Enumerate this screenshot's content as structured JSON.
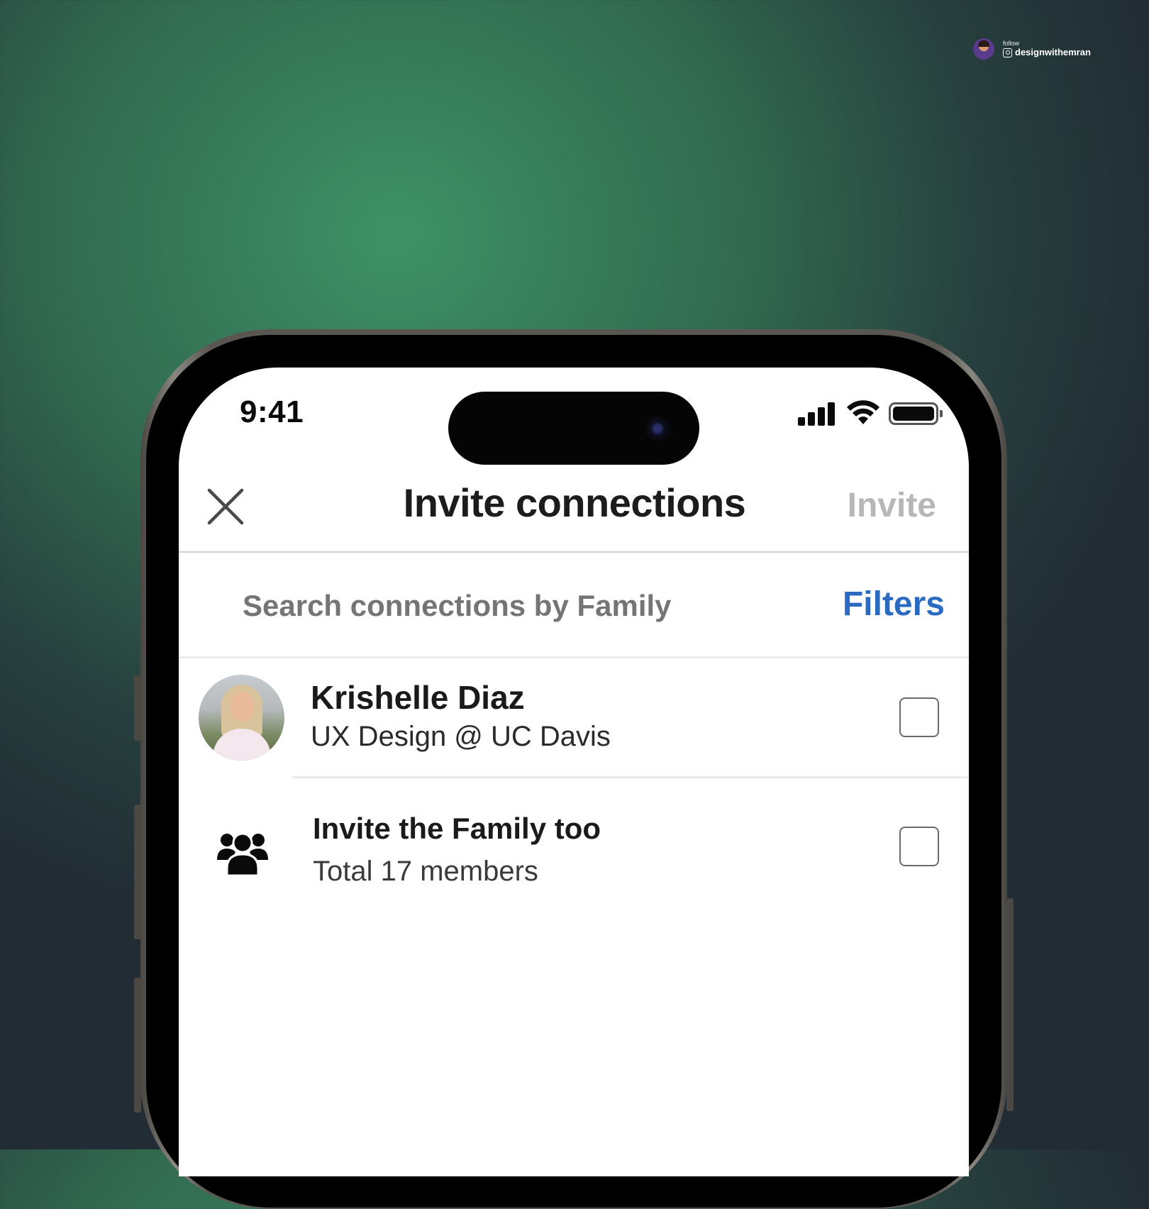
{
  "watermark": {
    "follow_label": "follow",
    "handle": "designwithemran",
    "icon": "instagram-icon"
  },
  "status_bar": {
    "time": "9:41",
    "icons": [
      "cellular-signal-icon",
      "wifi-icon",
      "battery-icon"
    ]
  },
  "header": {
    "close_icon": "close-icon",
    "title": "Invite connections",
    "invite_label": "Invite"
  },
  "search": {
    "placeholder": "Search connections by Family",
    "filters_label": "Filters"
  },
  "list": [
    {
      "name": "Krishelle Diaz",
      "subtitle": "UX Design @ UC Davis",
      "checked": false
    },
    {
      "icon": "family-group-icon",
      "name": "Invite the Family too",
      "subtitle": "Total 17 members",
      "checked": false
    }
  ],
  "colors": {
    "accent": "#2a6ac0",
    "disabled_text": "#b7b7b7",
    "background_green": "#3e9267",
    "background_dark": "#222c34"
  }
}
